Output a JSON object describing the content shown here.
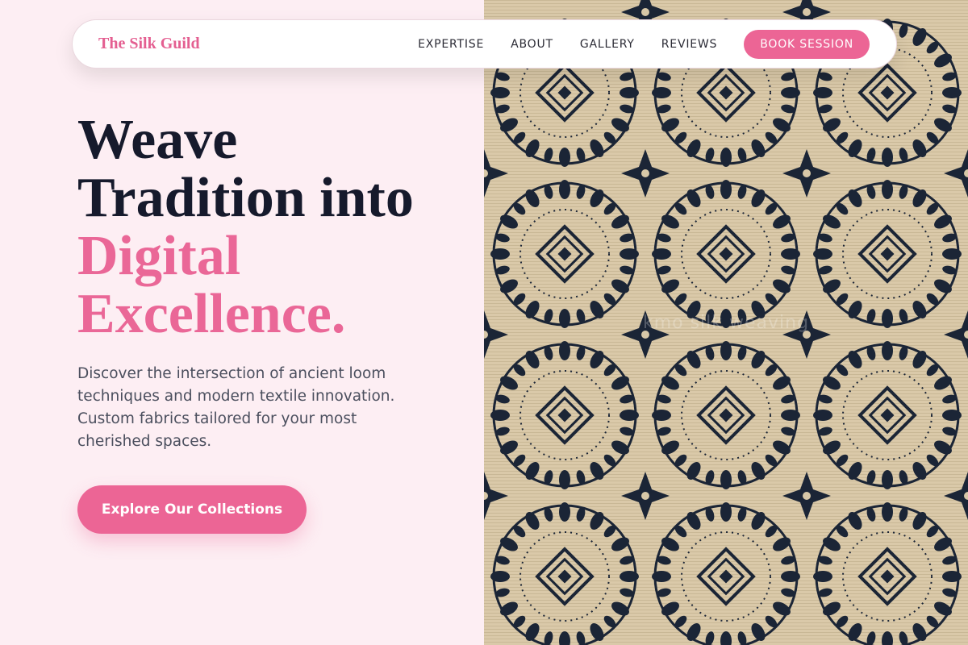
{
  "nav": {
    "brand": "The Silk Guild",
    "links": [
      "EXPERTISE",
      "ABOUT",
      "GALLERY",
      "REVIEWS"
    ],
    "cta_label": "BOOK SESSION"
  },
  "hero": {
    "headline_line1": "Weave",
    "headline_line2": "Tradition into",
    "headline_accent_line1": "Digital",
    "headline_accent_line2": "Excellence.",
    "description": "Discover the intersection of ancient loom techniques and modern textile innovation. Custom fabrics tailored for your most cherished spaces.",
    "cta_label": "Explore Our Collections"
  },
  "image": {
    "watermark": "kmo silk weaving"
  },
  "colors": {
    "background": "#fdeef3",
    "accent": "#ec6595",
    "heading": "#161a2c",
    "textile_base": "#d8c8a8",
    "textile_ink": "#1b2536"
  }
}
